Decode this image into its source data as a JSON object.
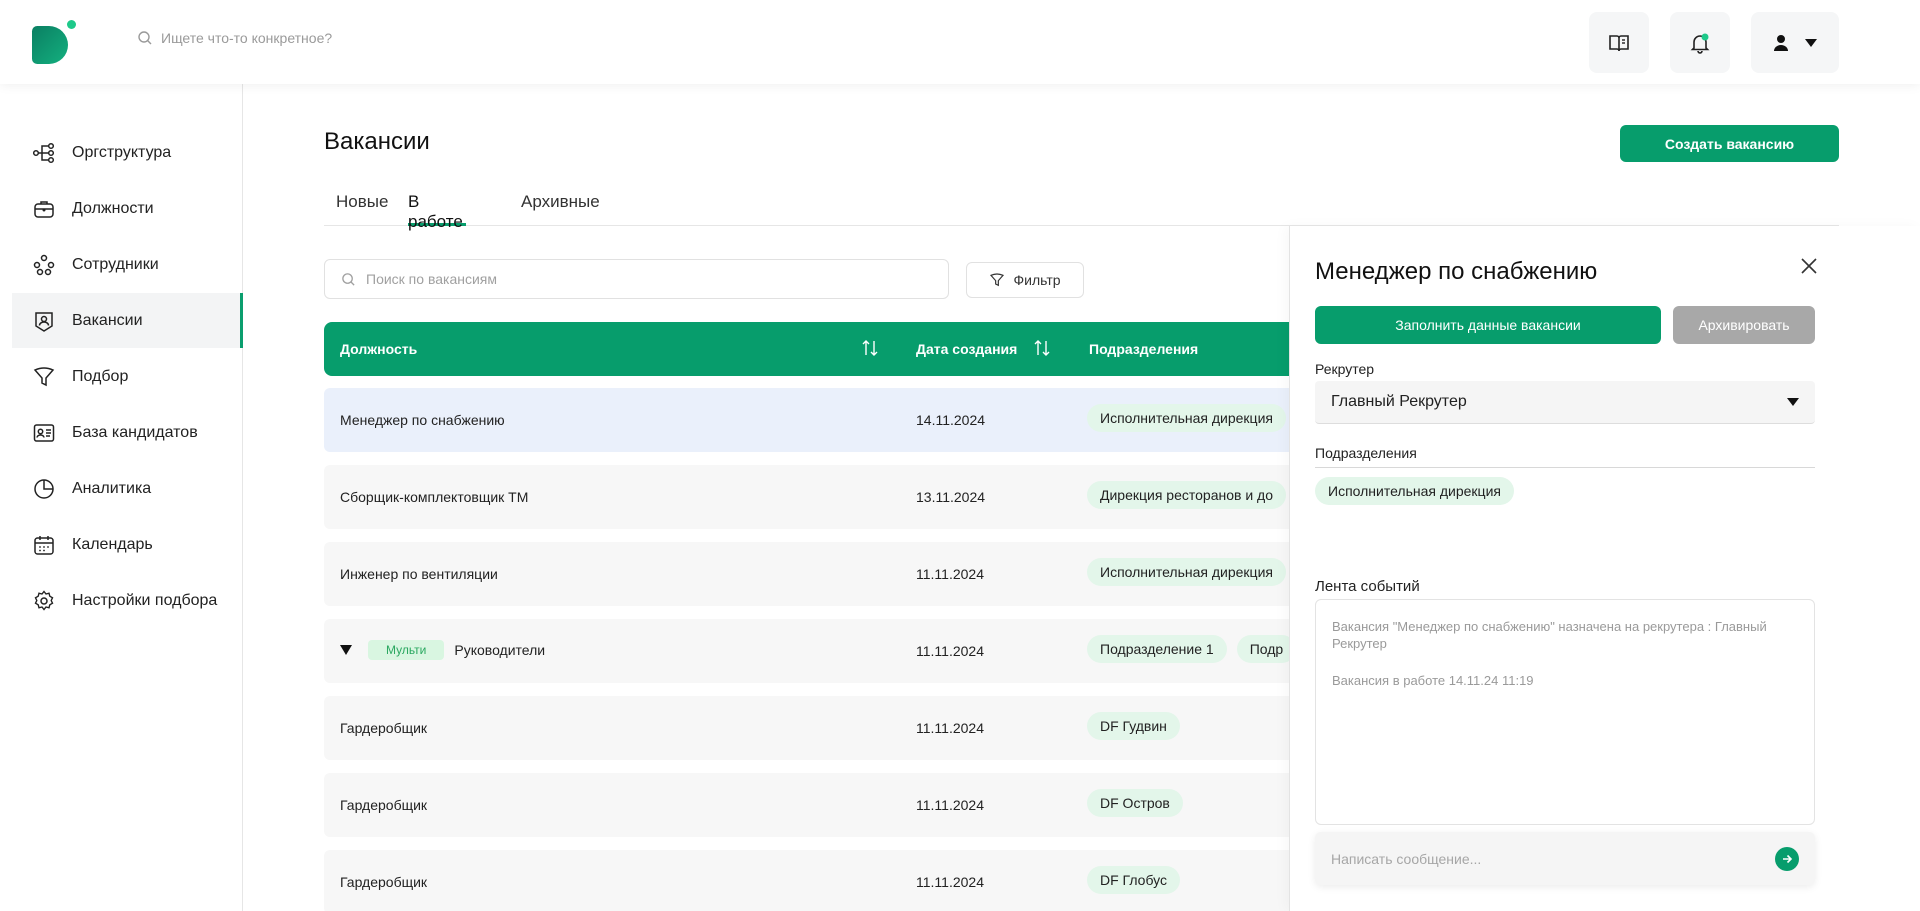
{
  "header": {
    "search_placeholder": "Ищете что-то конкретное?"
  },
  "sidebar": {
    "items": [
      {
        "label": "Оргструктура",
        "icon": "org-structure-icon"
      },
      {
        "label": "Должности",
        "icon": "briefcase-icon"
      },
      {
        "label": "Сотрудники",
        "icon": "employees-icon"
      },
      {
        "label": "Вакансии",
        "icon": "vacancy-icon",
        "active": true
      },
      {
        "label": "Подбор",
        "icon": "funnel-icon"
      },
      {
        "label": "База кандидатов",
        "icon": "id-card-icon"
      },
      {
        "label": "Аналитика",
        "icon": "pie-chart-icon"
      },
      {
        "label": "Календарь",
        "icon": "calendar-icon"
      },
      {
        "label": "Настройки подбора",
        "icon": "gear-icon"
      }
    ]
  },
  "main": {
    "title": "Вакансии",
    "create_button": "Создать вакансию",
    "tabs": [
      {
        "label": "Новые"
      },
      {
        "label": "В работе",
        "active": true
      },
      {
        "label": "Архивные"
      }
    ],
    "search_placeholder": "Поиск по вакансиям",
    "filter_label": "Фильтр",
    "columns": {
      "position": "Должность",
      "created": "Дата создания",
      "departments": "Подразделения"
    },
    "rows": [
      {
        "name": "Менеджер по снабжению",
        "date": "14.11.2024",
        "deps": [
          "Исполнительная дирекция"
        ],
        "selected": true
      },
      {
        "name": "Сборщик-комплектовщик ТМ",
        "date": "13.11.2024",
        "deps": [
          "Дирекция ресторанов и до"
        ]
      },
      {
        "name": "Инженер по вентиляции",
        "date": "11.11.2024",
        "deps": [
          "Исполнительная дирекция"
        ]
      },
      {
        "name": "Руководители",
        "date": "11.11.2024",
        "deps": [
          "Подразделение 1",
          "Подр"
        ],
        "multi": "Мульти"
      },
      {
        "name": "Гардеробщик",
        "date": "11.11.2024",
        "deps": [
          "DF Гудвин"
        ]
      },
      {
        "name": "Гардеробщик",
        "date": "11.11.2024",
        "deps": [
          "DF Остров"
        ]
      },
      {
        "name": "Гардеробщик",
        "date": "11.11.2024",
        "deps": [
          "DF Глобус"
        ]
      }
    ]
  },
  "panel": {
    "title": "Менеджер по снабжению",
    "fill_button": "Заполнить данные вакансии",
    "archive_button": "Архивировать",
    "recruiter_label": "Рекрутер",
    "recruiter_value": "Главный Рекрутер",
    "departments_label": "Подразделения",
    "department_chip": "Исполнительная дирекция",
    "feed_label": "Лента событий",
    "feed_events": [
      "Вакансия \"Менеджер по снабжению\" назначена на рекрутера : Главный Рекрутер",
      "Вакансия в работе 14.11.24 11:19"
    ],
    "message_placeholder": "Написать сообщение..."
  },
  "colors": {
    "accent": "#079d6c",
    "chip_bg": "#e3f6ea",
    "selected_row": "#eaf0fb",
    "archive_disabled": "#a8a8a8"
  }
}
